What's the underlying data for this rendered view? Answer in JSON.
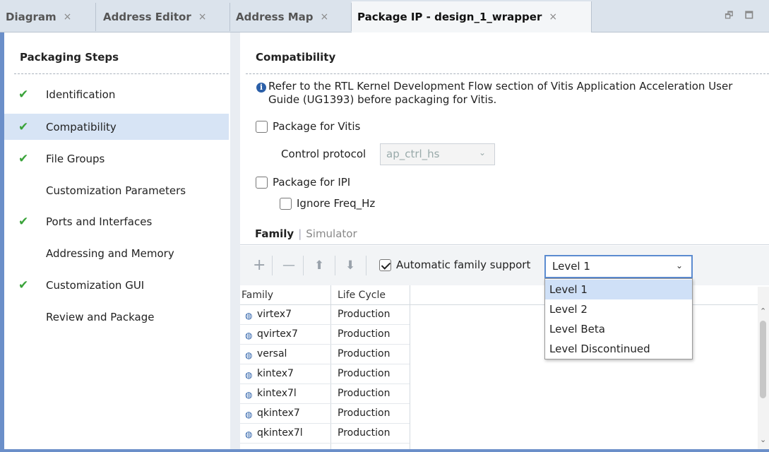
{
  "tabs": [
    {
      "label": "Diagram",
      "close": "×"
    },
    {
      "label": "Address Editor",
      "close": "×"
    },
    {
      "label": "Address Map",
      "close": "×"
    },
    {
      "label": "Package IP - design_1_wrapper",
      "close": "×"
    }
  ],
  "tab_tools": "🗗 🗖",
  "left": {
    "title": "Packaging Steps",
    "check_glyph": "✔",
    "steps": [
      {
        "label": "Identification",
        "done": true
      },
      {
        "label": "Compatibility",
        "done": true
      },
      {
        "label": "File Groups",
        "done": true
      },
      {
        "label": "Customization Parameters",
        "done": false
      },
      {
        "label": "Ports and Interfaces",
        "done": true
      },
      {
        "label": "Addressing and Memory",
        "done": false
      },
      {
        "label": "Customization GUI",
        "done": true
      },
      {
        "label": "Review and Package",
        "done": false
      }
    ]
  },
  "main": {
    "title": "Compatibility",
    "info_icon": "i",
    "info_text": "Refer to the RTL Kernel Development Flow section of Vitis Application Acceleration User Guide (UG1393) before packaging for Vitis.",
    "package_vitis_label": "Package for Vitis",
    "control_protocol_label": "Control protocol",
    "control_protocol_value": "ap_ctrl_hs",
    "package_ipi_label": "Package for IPI",
    "ignore_freq_label": "Ignore Freq_Hz",
    "subtab_family": "Family",
    "subtab_sep": "|",
    "subtab_simulator": "Simulator",
    "toolbar": {
      "add_glyph": "+",
      "remove_glyph": "—",
      "up_glyph": "⬆",
      "down_glyph": "⬇",
      "auto_family_label": "Automatic family support",
      "level_value": "Level 1",
      "chev": "⌄"
    },
    "table": {
      "headers": [
        "Family",
        "Life Cycle"
      ],
      "chip_glyph": "◍",
      "rows": [
        {
          "family": "virtex7",
          "life": "Production"
        },
        {
          "family": "qvirtex7",
          "life": "Production"
        },
        {
          "family": "versal",
          "life": "Production"
        },
        {
          "family": "kintex7",
          "life": "Production"
        },
        {
          "family": "kintex7l",
          "life": "Production"
        },
        {
          "family": "qkintex7",
          "life": "Production"
        },
        {
          "family": "qkintex7l",
          "life": "Production"
        }
      ]
    },
    "dropdown_options": [
      "Level 1",
      "Level 2",
      "Level Beta",
      "Level Discontinued"
    ],
    "scroll_up": "⌃",
    "scroll_down": "⌄"
  }
}
